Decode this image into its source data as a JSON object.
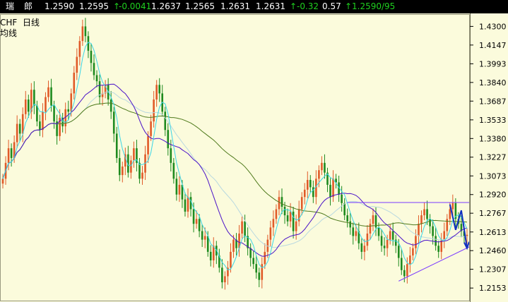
{
  "quote_bar": {
    "name_a": "瑞",
    "name_b": "郎",
    "last": "1.2590",
    "ask": "1.2595",
    "change": "-0.0041",
    "open": "1.2637",
    "low": "1.2565",
    "high": "1.2631",
    "close": "1.2631",
    "change_pct": "-0.32",
    "amp": "0.57",
    "bid_ask": "1.2590/95",
    "arrow": "↑"
  },
  "legend": {
    "symbol": "CHF",
    "period": "日线",
    "line2": "均线"
  },
  "colors": {
    "background": "#fbfbdc",
    "up_candle": "#e05a28",
    "down_candle": "#1e8a1e",
    "ma_cyan": "#3ad6e6",
    "ma_blue": "#4a12c8",
    "ma_olive": "#4f7a1c",
    "ma_light": "#b8d8e0",
    "trendline": "#7a3aff",
    "arrow": "#1030c0"
  },
  "chart_data": {
    "type": "candlestick",
    "title": "",
    "ylim": [
      1.205,
      1.4395
    ],
    "y_ticks": [
      "1.4300",
      "1.4147",
      "1.3993",
      "1.3840",
      "1.3687",
      "1.3533",
      "1.3380",
      "1.3227",
      "1.3073",
      "1.2920",
      "1.2767",
      "1.2613",
      "1.2460",
      "1.2307",
      "1.2153"
    ],
    "close": [
      1.305,
      1.318,
      1.33,
      1.322,
      1.335,
      1.35,
      1.342,
      1.358,
      1.37,
      1.36,
      1.378,
      1.365,
      1.352,
      1.345,
      1.36,
      1.372,
      1.38,
      1.365,
      1.352,
      1.34,
      1.355,
      1.348,
      1.362,
      1.36,
      1.375,
      1.392,
      1.405,
      1.418,
      1.43,
      1.422,
      1.41,
      1.4,
      1.39,
      1.385,
      1.372,
      1.375,
      1.382,
      1.37,
      1.36,
      1.342,
      1.322,
      1.308,
      1.315,
      1.325,
      1.31,
      1.32,
      1.33,
      1.318,
      1.305,
      1.31,
      1.325,
      1.34,
      1.352,
      1.37,
      1.382,
      1.375,
      1.36,
      1.345,
      1.33,
      1.318,
      1.305,
      1.292,
      1.3,
      1.288,
      1.278,
      1.29,
      1.28,
      1.268,
      1.272,
      1.262,
      1.255,
      1.258,
      1.245,
      1.238,
      1.25,
      1.242,
      1.232,
      1.22,
      1.225,
      1.232,
      1.245,
      1.255,
      1.248,
      1.26,
      1.27,
      1.258,
      1.248,
      1.24,
      1.235,
      1.228,
      1.222,
      1.235,
      1.245,
      1.255,
      1.265,
      1.272,
      1.28,
      1.29,
      1.282,
      1.275,
      1.27,
      1.278,
      1.262,
      1.27,
      1.28,
      1.29,
      1.296,
      1.304,
      1.298,
      1.29,
      1.305,
      1.312,
      1.318,
      1.31,
      1.3,
      1.29,
      1.305,
      1.302,
      1.292,
      1.285,
      1.275,
      1.27,
      1.265,
      1.258,
      1.262,
      1.252,
      1.245,
      1.25,
      1.26,
      1.268,
      1.275,
      1.265,
      1.258,
      1.25,
      1.248,
      1.255,
      1.262,
      1.255,
      1.25,
      1.24,
      1.23,
      1.225,
      1.235,
      1.242,
      1.248,
      1.258,
      1.268,
      1.275,
      1.28,
      1.272,
      1.266,
      1.258,
      1.25,
      1.245,
      1.255,
      1.262,
      1.272,
      1.28,
      1.285,
      1.272,
      1.268,
      1.262,
      1.258,
      1.259
    ]
  }
}
